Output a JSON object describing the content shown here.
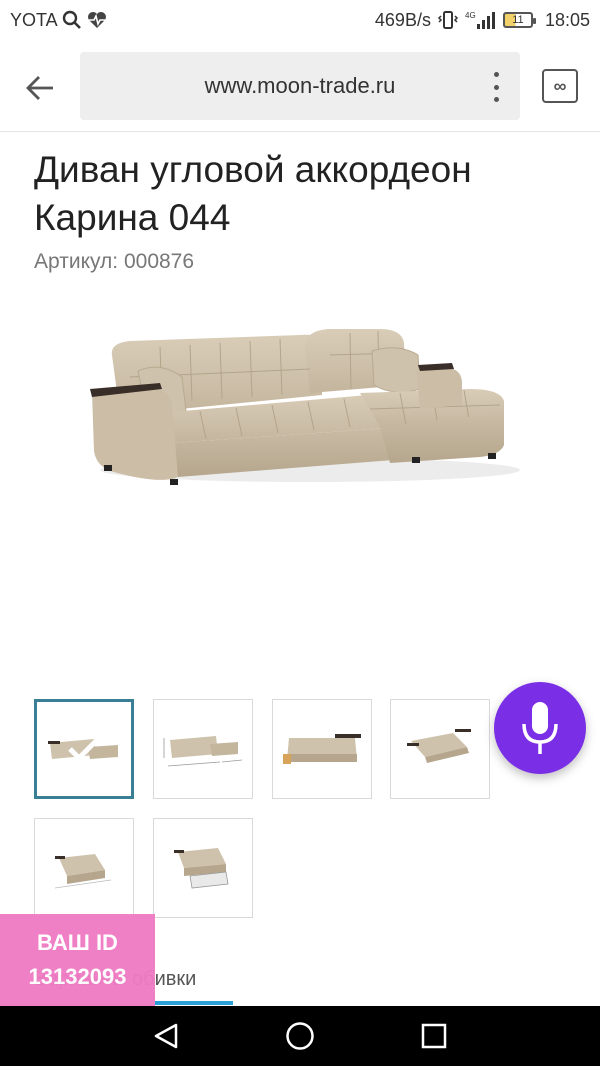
{
  "status_bar": {
    "carrier": "YOTA",
    "speed": "469B/s",
    "network": "4G",
    "battery": "11",
    "time": "18:05"
  },
  "browser": {
    "url": "www.moon-trade.ru",
    "tabs_label": "∞"
  },
  "product": {
    "title": "Диван угловой аккордеон Карина 044",
    "article": "Артикул: 000876",
    "upholstery_color": "#cfc2ad"
  },
  "thumbnails": [
    {
      "name": "thumb-1",
      "active": true
    },
    {
      "name": "thumb-2",
      "active": false
    },
    {
      "name": "thumb-3",
      "active": false
    },
    {
      "name": "thumb-4",
      "active": false
    },
    {
      "name": "thumb-5",
      "active": false
    },
    {
      "name": "thumb-6",
      "active": false
    }
  ],
  "variants_tab": "Варианты обивки",
  "id_badge": {
    "line1": "ВАШ ID",
    "line2": "13132093"
  },
  "colors": {
    "voice_button": "#7a2ee6",
    "id_badge": "#f07bc4",
    "active_thumb_border": "#3a7f95",
    "tab_underline": "#2a9fd8"
  }
}
